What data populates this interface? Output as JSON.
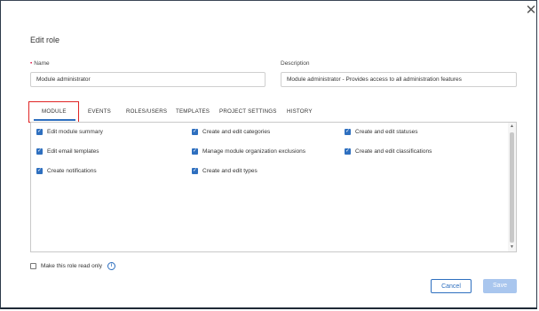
{
  "dialog": {
    "title": "Edit role",
    "close_glyph": "✕"
  },
  "form": {
    "name_label": "Name",
    "name_required_mark": "•",
    "name_value": "Module administrator",
    "description_label": "Description",
    "description_value": "Module administrator - Provides access to all administration features"
  },
  "tabs": [
    {
      "label": "MODULE",
      "active": true
    },
    {
      "label": "EVENTS"
    },
    {
      "label": "ROLES/USERS"
    },
    {
      "label": "TEMPLATES"
    },
    {
      "label": "PROJECT SETTINGS"
    },
    {
      "label": "HISTORY"
    }
  ],
  "permissions": [
    {
      "label": "Edit module summary",
      "checked": true
    },
    {
      "label": "Create and edit categories",
      "checked": true
    },
    {
      "label": "Create and edit statuses",
      "checked": true
    },
    {
      "label": "Edit email templates",
      "checked": true
    },
    {
      "label": "Manage module organization exclusions",
      "checked": true
    },
    {
      "label": "Create and edit classifications",
      "checked": true
    },
    {
      "label": "Create notifications",
      "checked": true
    },
    {
      "label": "Create and edit types",
      "checked": true
    }
  ],
  "read_only": {
    "label": "Make this role read only",
    "checked": false,
    "info_glyph": "i"
  },
  "footer": {
    "cancel_label": "Cancel",
    "save_label": "Save"
  },
  "colors": {
    "accent": "#2e6fbf",
    "highlight": "#e02525",
    "save_disabled": "#a9c6ee"
  }
}
